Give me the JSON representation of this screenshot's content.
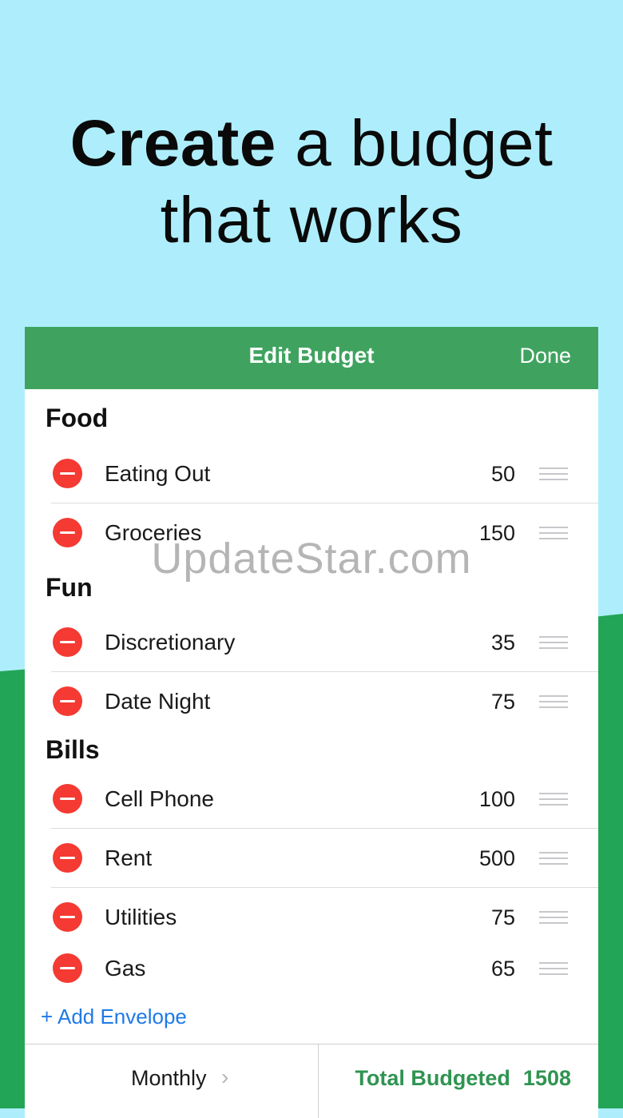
{
  "headline": {
    "bold": "Create",
    "rest_line1": " a budget",
    "line2": "that works"
  },
  "navbar": {
    "title": "Edit Budget",
    "done": "Done"
  },
  "sections": [
    {
      "title": "Food",
      "items": [
        {
          "label": "Eating Out",
          "amount": "50"
        },
        {
          "label": "Groceries",
          "amount": "150"
        }
      ]
    },
    {
      "title": "Fun",
      "items": [
        {
          "label": "Discretionary",
          "amount": "35"
        },
        {
          "label": "Date Night",
          "amount": "75"
        }
      ]
    },
    {
      "title": "Bills",
      "items": [
        {
          "label": "Cell Phone",
          "amount": "100"
        },
        {
          "label": "Rent",
          "amount": "500"
        },
        {
          "label": "Utilities",
          "amount": "75"
        },
        {
          "label": "Gas",
          "amount": "65"
        }
      ]
    }
  ],
  "add_envelope": "+ Add Envelope",
  "bottom": {
    "frequency": "Monthly",
    "frequency_chevron": "›",
    "total_label": "Total Budgeted",
    "total_value": "1508"
  },
  "watermark": "UpdateStar.com",
  "colors": {
    "sky": "#aeeefc",
    "green_bg": "#23a557",
    "navbar": "#3fa35f",
    "delete": "#f43a32",
    "link": "#1f7ae6",
    "total": "#2f9451"
  }
}
